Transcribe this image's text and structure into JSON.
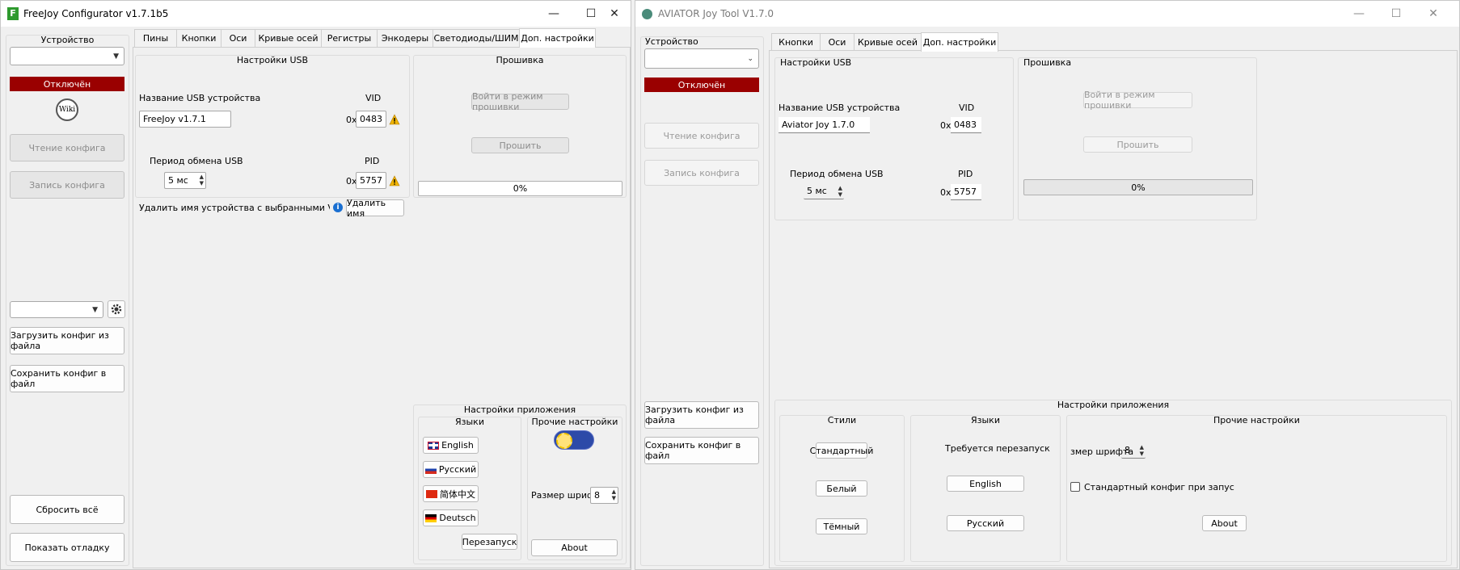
{
  "win1": {
    "title": "FreeJoy Configurator v1.7.1b5",
    "device_group": "Устройство",
    "status": "Отключён",
    "wiki": "Wiki",
    "read_config": "Чтение конфига",
    "write_config": "Запись конфига",
    "load_file": "Загрузить конфиг из файла",
    "save_file": "Сохранить конфиг в файл",
    "reset_all": "Сбросить всё",
    "show_debug": "Показать отладку",
    "tabs": [
      "Пины",
      "Кнопки",
      "Оси",
      "Кривые осей",
      "Регистры",
      "Энкодеры",
      "Светодиоды/ШИМ",
      "Доп. настройки"
    ],
    "usb": {
      "group": "Настройки USB",
      "name_label": "Название USB устройства",
      "name_value": "FreeJoy v1.7.1",
      "vid_label": "VID",
      "vid_prefix": "0x",
      "vid_value": "0483",
      "period_label": "Период обмена USB",
      "period_value": "5 мс",
      "pid_label": "PID",
      "pid_prefix": "0x",
      "pid_value": "5757",
      "delete_label": "Удалить имя устройства с выбранными VID/PID из ре",
      "delete_button": "Удалить имя"
    },
    "firmware": {
      "group": "Прошивка",
      "enter_mode": "Войти в режим прошивки",
      "flash": "Прошить",
      "progress": "0%"
    },
    "app": {
      "group": "Настройки приложения",
      "languages_group": "Языки",
      "languages": [
        "English",
        "Русский",
        "简体中文",
        "Deutsch"
      ],
      "restart": "Перезапуск",
      "other_group": "Прочие настройки",
      "font_size_label": "Размер шрифта",
      "font_size_value": "8",
      "about": "About"
    }
  },
  "win2": {
    "title": "AVIATOR Joy Tool V1.7.0",
    "device_group": "Устройство",
    "status": "Отключён",
    "read_config": "Чтение конфига",
    "write_config": "Запись конфига",
    "load_file": "Загрузить конфиг из файла",
    "save_file": "Сохранить конфиг в файл",
    "tabs": [
      "Кнопки",
      "Оси",
      "Кривые осей",
      "Доп. настройки"
    ],
    "usb": {
      "group": "Настройки USB",
      "name_label": "Название USB устройства",
      "name_value": "Aviator Joy 1.7.0",
      "vid_label": "VID",
      "vid_prefix": "0x",
      "vid_value": "0483",
      "period_label": "Период обмена USB",
      "period_value": "5 мс",
      "pid_label": "PID",
      "pid_prefix": "0x",
      "pid_value": "5757"
    },
    "firmware": {
      "group": "Прошивка",
      "enter_mode": "Войти в режим прошивки",
      "flash": "Прошить",
      "progress": "0%"
    },
    "app": {
      "group": "Настройки приложения",
      "styles_group": "Стили",
      "styles": [
        "Стандартный",
        "Белый",
        "Тёмный"
      ],
      "languages_group": "Языки",
      "restart_required": "Требуется перезапуск",
      "languages": [
        "English",
        "Русский"
      ],
      "other_group": "Прочие настройки",
      "font_size_label": "змер шрифта",
      "font_size_value": "8",
      "std_config_label": "Стандартный конфиг при запус",
      "about": "About"
    }
  },
  "colors": {
    "status_red": "#9a0000",
    "warn_yellow": "#f0b400",
    "info_blue": "#1a6fd1"
  }
}
